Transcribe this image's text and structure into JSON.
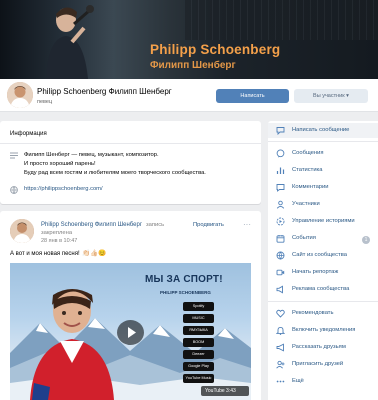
{
  "cover": {
    "title": "Philipp Schoenberg",
    "subtitle": "Филипп Шенберг"
  },
  "header": {
    "name": "Philipp Schoenberg Филипп Шенберг",
    "status": "певец",
    "write_button": "Написать",
    "member_button": "Вы участник ▾"
  },
  "info": {
    "title": "Информация",
    "lines": [
      "Филипп Шенберг — певец, музыкант, композитор.",
      "И просто хороший парень!",
      "Буду рад всем гостям и любителям моего творческого сообщества."
    ],
    "link": "https://philippschoenberg.com/"
  },
  "post": {
    "author": "Philipp Schoenberg Филипп Шенберг",
    "pinned_1": "запись",
    "pinned_2": "закреплена",
    "date": "28 янв в 10:47",
    "share": "Продвигать",
    "more": "···",
    "text": "А вот и моя новая песня!",
    "emoji": "👏🏻👍🏻😊",
    "video": {
      "title": "МЫ ЗА СПОРТ!",
      "artist": "PHILIPP SCHOENBERG",
      "stores": [
        "Spotify",
        "MUSIC",
        "ЯМУЗЫКА",
        "BOOM",
        "Deezer",
        "Google Play",
        "YouTube Music"
      ],
      "badge": "YouTube  3:43"
    }
  },
  "sidebar": {
    "items": [
      {
        "label": "Написать сообщение",
        "icon": "message-icon"
      },
      {
        "label": "Сообщения",
        "icon": "messages-icon"
      },
      {
        "label": "Статистика",
        "icon": "stats-icon"
      },
      {
        "label": "Комментарии",
        "icon": "comments-icon"
      },
      {
        "label": "Участники",
        "icon": "members-icon"
      },
      {
        "label": "Управление историями",
        "icon": "stories-icon"
      },
      {
        "label": "События",
        "icon": "events-icon"
      },
      {
        "label": "Сайт из сообщества",
        "icon": "site-icon"
      },
      {
        "label": "Начать репортаж",
        "icon": "broadcast-icon"
      },
      {
        "label": "Реклама сообщества",
        "icon": "ads-icon"
      },
      {
        "label": "Рекомендовать",
        "icon": "recommend-icon"
      },
      {
        "label": "Включить уведомления",
        "icon": "bell-icon"
      },
      {
        "label": "Рассказать друзьям",
        "icon": "megaphone-icon"
      },
      {
        "label": "Пригласить друзей",
        "icon": "invite-icon"
      },
      {
        "label": "Ещё",
        "icon": "more-icon"
      }
    ],
    "events_badge": "1"
  },
  "colors": {
    "accent": "#5181b8",
    "link": "#2a5885",
    "cover_title": "#f4a04a"
  }
}
